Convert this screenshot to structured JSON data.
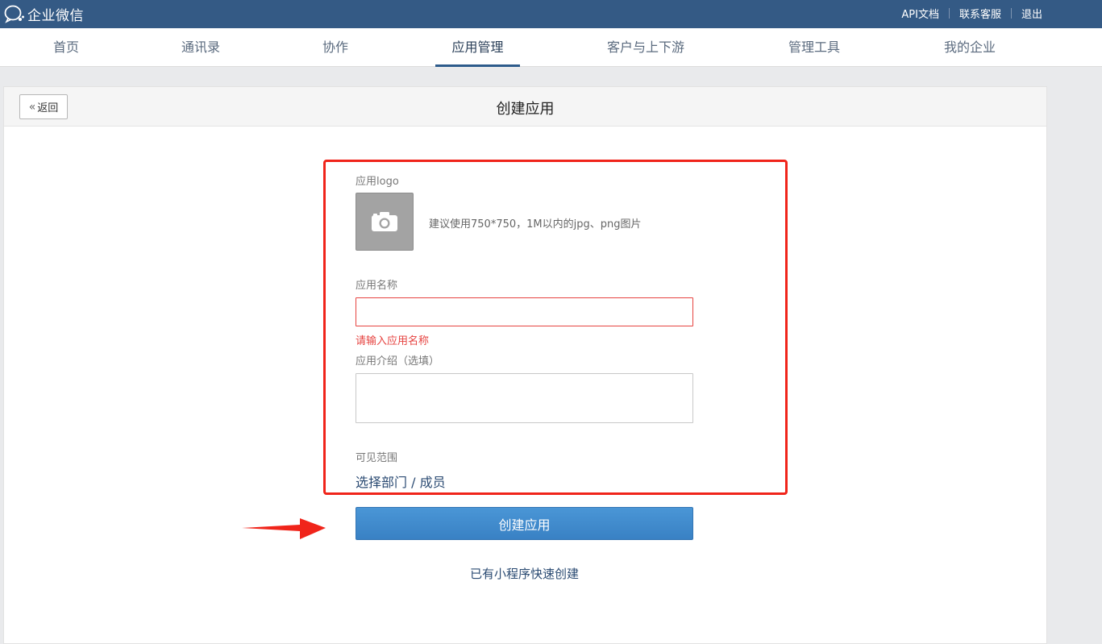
{
  "brand": {
    "name": "企业微信"
  },
  "toplinks": {
    "api_docs": "API文档",
    "support": "联系客服",
    "logout": "退出"
  },
  "nav": {
    "items": [
      {
        "label": "首页"
      },
      {
        "label": "通讯录"
      },
      {
        "label": "协作"
      },
      {
        "label": "应用管理",
        "active": true
      },
      {
        "label": "客户与上下游"
      },
      {
        "label": "管理工具"
      },
      {
        "label": "我的企业"
      }
    ]
  },
  "panel": {
    "back_label": "返回",
    "title": "创建应用"
  },
  "form": {
    "logo_label": "应用logo",
    "logo_icon": "camera-icon",
    "logo_hint": "建议使用750*750，1M以内的jpg、png图片",
    "name_label": "应用名称",
    "name_value": "",
    "name_error": "请输入应用名称",
    "intro_label": "应用介绍（选填）",
    "intro_value": "",
    "visibility_label": "可见范围",
    "visibility_link": "选择部门 / 成员",
    "submit_label": "创建应用",
    "miniprogram_link": "已有小程序快速创建"
  },
  "colors": {
    "topbar": "#345a85",
    "nav_active_underline": "#2d5b8b",
    "primary_button": "#3981c4",
    "error": "#e64340",
    "annotation": "#f0241a"
  }
}
